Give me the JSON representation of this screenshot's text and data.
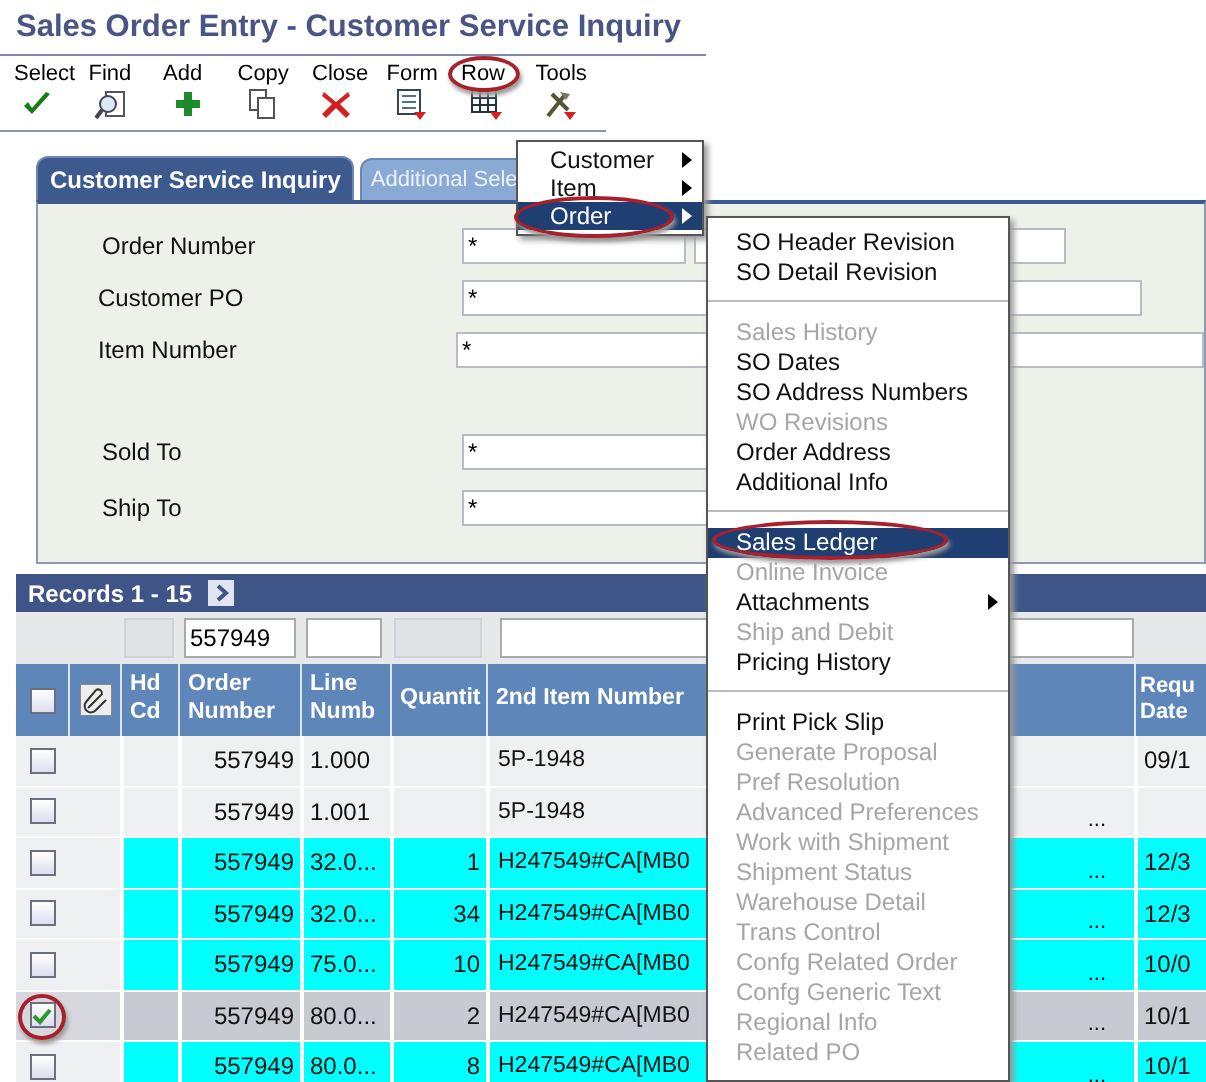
{
  "window": {
    "title": "Sales Order Entry - Customer Service Inquiry"
  },
  "toolbar": [
    {
      "label": "Select",
      "circled": false
    },
    {
      "label": "Find",
      "circled": false
    },
    {
      "label": "Add",
      "circled": false
    },
    {
      "label": "Copy",
      "circled": false
    },
    {
      "label": "Close",
      "circled": false
    },
    {
      "label": "Form",
      "circled": false
    },
    {
      "label": "Row",
      "circled": true
    },
    {
      "label": "Tools",
      "circled": false
    }
  ],
  "tabs": [
    {
      "label": "Customer Service Inquiry",
      "selected": true
    },
    {
      "label": "Additional Sele",
      "selected": false
    }
  ],
  "fields": [
    {
      "label": "Order Number",
      "value": "*",
      "kind": "split"
    },
    {
      "label": "Customer PO",
      "value": "*",
      "kind": "wide"
    },
    {
      "label": "Item Number",
      "value": "*",
      "kind": "full"
    },
    {
      "label": "Sold To",
      "value": "*",
      "kind": "plain"
    },
    {
      "label": "Ship To",
      "value": "*",
      "kind": "plain"
    }
  ],
  "records": {
    "label": "Records 1 - 15"
  },
  "filter": {
    "order_number": "557949"
  },
  "table": {
    "header_checkbox": {
      "checked": false
    },
    "columns": [
      "Hd Cd",
      "Order Number",
      "Line Numb",
      "Quantit",
      "2nd Item Number",
      "Requ Date"
    ],
    "rows": [
      {
        "checked": false,
        "circled": false,
        "selected": false,
        "highlighted": false,
        "order_number": "557949",
        "line_number": "1.000",
        "item": "5P-1948",
        "date": "09/1"
      },
      {
        "checked": false,
        "circled": false,
        "selected": false,
        "highlighted": false,
        "order_number": "557949",
        "line_number": "1.001",
        "item": "5P-1948",
        "more": "..."
      },
      {
        "checked": false,
        "circled": false,
        "selected": false,
        "highlighted": true,
        "order_number": "557949",
        "line_number": "32.0...",
        "quantity": "1",
        "item": "H247549#CA[MB0",
        "more": "...",
        "date": "12/3"
      },
      {
        "checked": false,
        "circled": false,
        "selected": false,
        "highlighted": true,
        "order_number": "557949",
        "line_number": "32.0...",
        "quantity": "34",
        "item": "H247549#CA[MB0",
        "more": "...",
        "date": "12/3"
      },
      {
        "checked": false,
        "circled": false,
        "selected": false,
        "highlighted": true,
        "order_number": "557949",
        "line_number": "75.0...",
        "quantity": "10",
        "item": "H247549#CA[MB0",
        "more": "...",
        "date": "10/0"
      },
      {
        "checked": true,
        "circled": true,
        "selected": true,
        "highlighted": false,
        "order_number": "557949",
        "line_number": "80.0...",
        "quantity": "2",
        "item": "H247549#CA[MB0",
        "more": "...",
        "date": "10/1"
      },
      {
        "checked": false,
        "circled": false,
        "selected": false,
        "highlighted": true,
        "order_number": "557949",
        "line_number": "80.0...",
        "quantity": "8",
        "item": "H247549#CA[MB0",
        "more": "...",
        "date": "10/1"
      }
    ]
  },
  "row_menu": [
    {
      "label": "Customer",
      "kind": "submenu",
      "selected": false,
      "circled": false
    },
    {
      "label": "Item",
      "kind": "submenu",
      "selected": false,
      "circled": false
    },
    {
      "label": "Order",
      "kind": "submenu",
      "selected": true,
      "circled": true
    }
  ],
  "order_menu": [
    [
      {
        "label": "SO Header Revision",
        "kind": "command",
        "disabled": false,
        "selected": false,
        "circled": false
      },
      {
        "label": "SO Detail Revision",
        "kind": "command",
        "disabled": false,
        "selected": false,
        "circled": false
      }
    ],
    [
      {
        "label": "Sales History",
        "kind": "command",
        "disabled": true,
        "selected": false,
        "circled": false
      },
      {
        "label": "SO Dates",
        "kind": "command",
        "disabled": false,
        "selected": false,
        "circled": false
      },
      {
        "label": "SO Address Numbers",
        "kind": "command",
        "disabled": false,
        "selected": false,
        "circled": false
      },
      {
        "label": "WO Revisions",
        "kind": "command",
        "disabled": true,
        "selected": false,
        "circled": false
      },
      {
        "label": "Order Address",
        "kind": "command",
        "disabled": false,
        "selected": false,
        "circled": false
      },
      {
        "label": "Additional Info",
        "kind": "command",
        "disabled": false,
        "selected": false,
        "circled": false
      }
    ],
    [
      {
        "label": "Sales Ledger",
        "kind": "command",
        "disabled": false,
        "selected": true,
        "circled": true
      },
      {
        "label": "Online Invoice",
        "kind": "command",
        "disabled": true,
        "selected": false,
        "circled": false
      },
      {
        "label": "Attachments",
        "kind": "submenu",
        "disabled": false,
        "selected": false,
        "circled": false
      },
      {
        "label": "Ship and Debit",
        "kind": "command",
        "disabled": true,
        "selected": false,
        "circled": false
      },
      {
        "label": "Pricing History",
        "kind": "command",
        "disabled": false,
        "selected": false,
        "circled": false
      }
    ],
    [
      {
        "label": "Print Pick Slip",
        "kind": "command",
        "disabled": false,
        "selected": false,
        "circled": false
      },
      {
        "label": "Generate Proposal",
        "kind": "command",
        "disabled": true,
        "selected": false,
        "circled": false
      },
      {
        "label": "Pref Resolution",
        "kind": "command",
        "disabled": true,
        "selected": false,
        "circled": false
      },
      {
        "label": "Advanced Preferences",
        "kind": "command",
        "disabled": true,
        "selected": false,
        "circled": false
      },
      {
        "label": "Work with Shipment",
        "kind": "command",
        "disabled": true,
        "selected": false,
        "circled": false
      },
      {
        "label": "Shipment Status",
        "kind": "command",
        "disabled": true,
        "selected": false,
        "circled": false
      },
      {
        "label": "Warehouse Detail",
        "kind": "command",
        "disabled": true,
        "selected": false,
        "circled": false
      },
      {
        "label": "Trans Control",
        "kind": "command",
        "disabled": true,
        "selected": false,
        "circled": false
      },
      {
        "label": "Confg Related Order",
        "kind": "command",
        "disabled": true,
        "selected": false,
        "circled": false
      },
      {
        "label": "Confg Generic Text",
        "kind": "command",
        "disabled": true,
        "selected": false,
        "circled": false
      },
      {
        "label": "Regional Info",
        "kind": "command",
        "disabled": true,
        "selected": false,
        "circled": false
      },
      {
        "label": "Related PO",
        "kind": "command",
        "disabled": true,
        "selected": false,
        "circled": false
      }
    ]
  ]
}
